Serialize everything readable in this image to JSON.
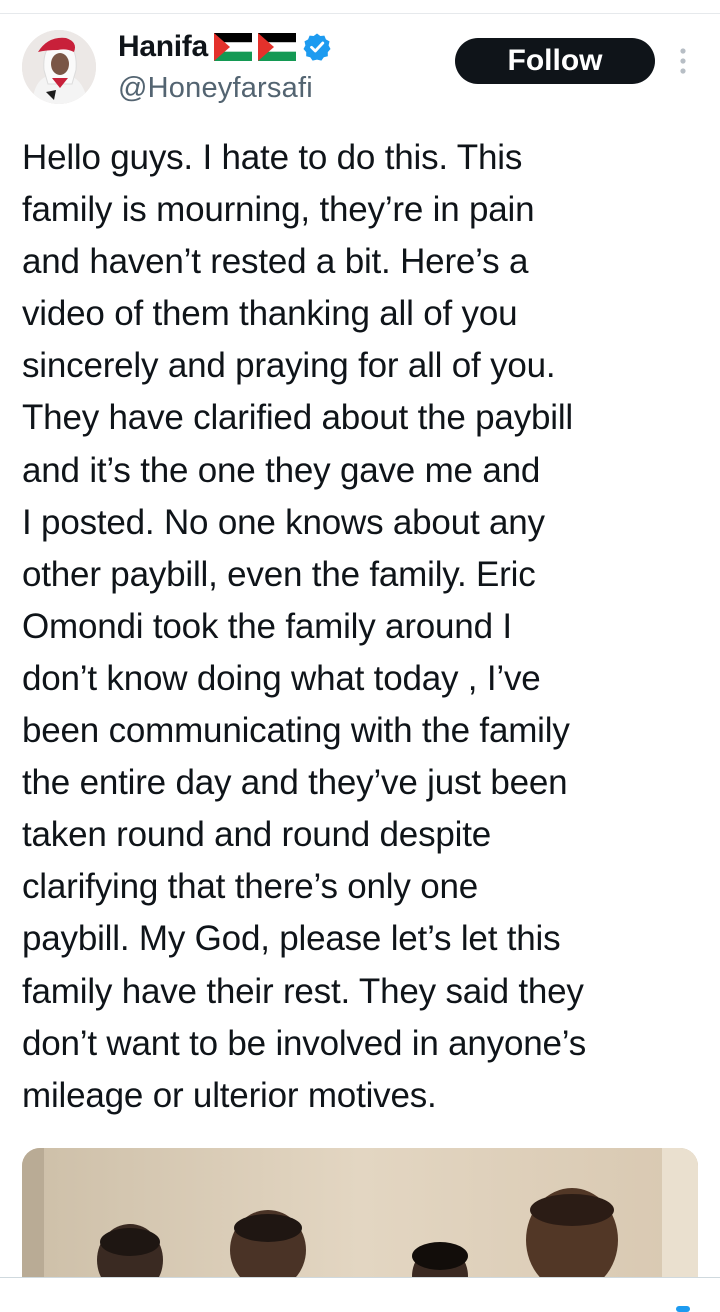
{
  "author": {
    "name": "Hanifa",
    "handle": "@Honeyfarsafi",
    "flags": [
      "palestine-flag-icon",
      "palestine-flag-icon"
    ],
    "verified": true,
    "avatar": "profile-photo"
  },
  "actions": {
    "follow_label": "Follow",
    "more_icon": "more-vertical-icon"
  },
  "tweet": {
    "lines": [
      "Hello guys. I hate to do this. This",
      "family is mourning, they’re in pain",
      "and haven’t rested a bit. Here’s a",
      "video of them thanking all of you",
      "sincerely and praying for all of you.",
      "They have clarified about the paybill",
      "and it’s the one they gave me and",
      "I posted. No one knows about any",
      "other paybill, even the family. Eric",
      "Omondi took the family around I",
      "don’t know doing what today , I’ve",
      "been communicating with the family",
      "the entire day and they’ve just been",
      "taken round and round despite",
      "clarifying that there’s only one",
      "paybill. My God, please let’s let this",
      "family have their rest. They said they",
      "don’t want to be involved in anyone’s",
      "mileage or ulterior motives."
    ]
  },
  "media": {
    "type": "video-thumbnail",
    "subject": "family-members-photo"
  },
  "colors": {
    "text": "#0f1419",
    "secondary": "#536471",
    "verified": "#1d9bf0",
    "follow_bg": "#0f1419",
    "divider": "#e6e9ec"
  }
}
